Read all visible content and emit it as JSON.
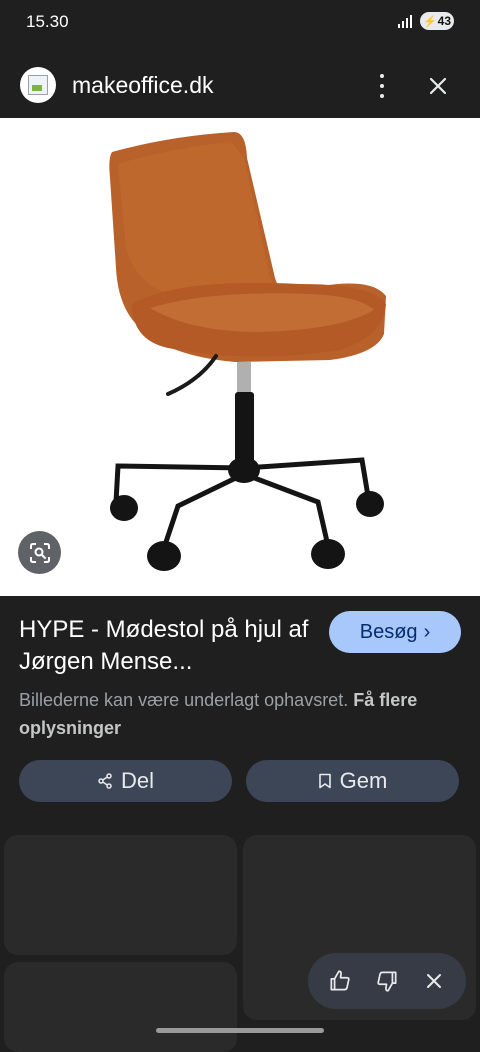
{
  "status_bar": {
    "time": "15.30",
    "battery": "43"
  },
  "header": {
    "site": "makeoffice.dk"
  },
  "result": {
    "title": "HYPE - Mødestol på hjul af Jørgen Mense...",
    "visit_label": "Besøg",
    "visit_chevron": "›",
    "copyright_text": "Billederne kan være underlagt ophavsret.",
    "more_info_link": "Få flere oplysninger",
    "share_label": "Del",
    "save_label": "Gem"
  },
  "icons": [
    "signal-icon",
    "battery-icon",
    "favicon-icon",
    "more-options-icon",
    "close-icon",
    "lens-search-icon",
    "chevron-right-icon",
    "share-icon",
    "bookmark-icon",
    "thumbs-up-icon",
    "thumbs-down-icon",
    "dismiss-icon"
  ],
  "colors": {
    "background": "#1f1f1f",
    "visit_button": "#a8c7fa",
    "action_button": "#3c4656",
    "chair_leather": "#b8612b"
  }
}
